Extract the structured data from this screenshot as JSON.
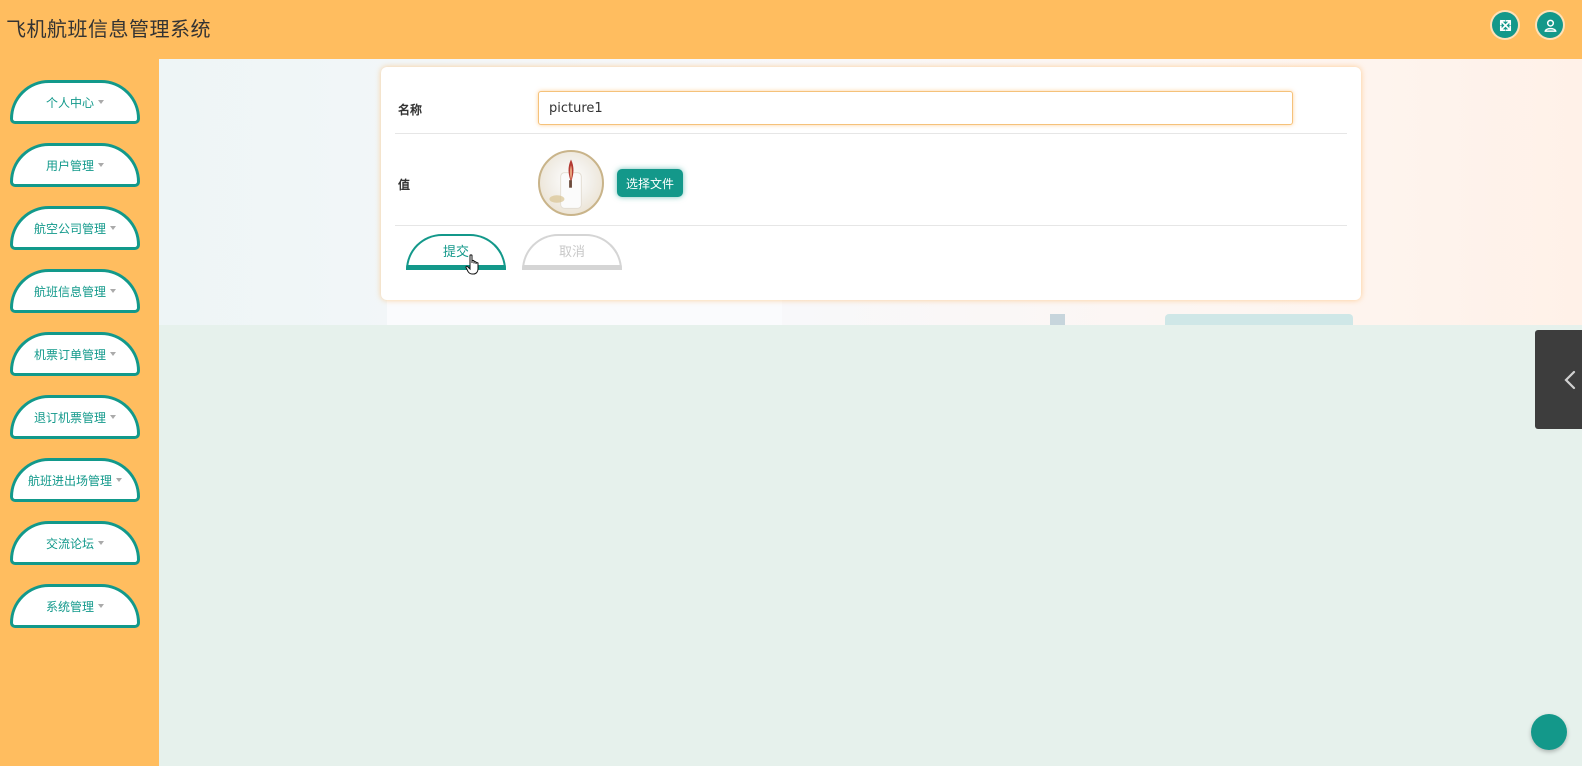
{
  "header": {
    "title": "飞机航班信息管理系统",
    "icons": [
      "fullscreen-icon",
      "user-icon"
    ]
  },
  "sidebar": {
    "items": [
      {
        "label": "个人中心"
      },
      {
        "label": "用户管理"
      },
      {
        "label": "航空公司管理"
      },
      {
        "label": "航班信息管理"
      },
      {
        "label": "机票订单管理"
      },
      {
        "label": "退订机票管理"
      },
      {
        "label": "航班进出场管理"
      },
      {
        "label": "交流论坛"
      },
      {
        "label": "系统管理"
      }
    ]
  },
  "form": {
    "name_label": "名称",
    "name_value": "picture1",
    "value_label": "值",
    "choose_file_label": "选择文件",
    "submit_label": "提交",
    "cancel_label": "取消"
  },
  "colors": {
    "accent": "#13988a",
    "header_bg": "#ffbd5f",
    "page_bg": "#e6f1ec"
  }
}
